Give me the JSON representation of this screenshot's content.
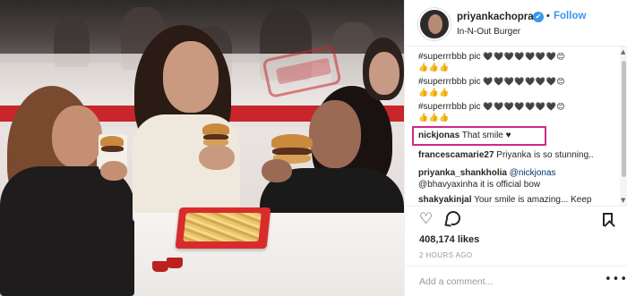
{
  "post": {
    "username": "priyankachopra",
    "verified_mark": "✔",
    "separator": "•",
    "follow_label": "Follow",
    "location": "In-N-Out Burger"
  },
  "comments": [
    {
      "user": "",
      "text": "#superrrbbb pic",
      "emoji": "🖤🖤🖤🖤🖤🖤🖤😊",
      "emoji2": "👍👍👍"
    },
    {
      "user": "",
      "text": "#superrrbbb pic",
      "emoji": "🖤🖤🖤🖤🖤🖤🖤😊",
      "emoji2": "👍👍👍"
    },
    {
      "user": "",
      "text": "#superrrbbb pic",
      "emoji": "🖤🖤🖤🖤🖤🖤🖤😊",
      "emoji2": "👍👍👍"
    },
    {
      "user": "nickjonas",
      "text": "That smile ♥",
      "highlighted": true
    },
    {
      "user": "francescamarie27",
      "text": "Priyanka is so stunning.."
    },
    {
      "user": "priyanka_shankholia",
      "text": "@nickjonas"
    },
    {
      "user": "",
      "text": "@bhavyaxinha it is official bow"
    },
    {
      "user": "shakyakinjal",
      "text": "Your smile is amazing... Keep"
    }
  ],
  "scroll": {
    "up": "▲",
    "down": "▼"
  },
  "actions": {
    "like_icon": "♡",
    "comment_icon": "comment-icon",
    "save_icon": "bookmark-icon"
  },
  "likes": "408,174 likes",
  "timestamp": "2 HOURS AGO",
  "add_comment": {
    "placeholder": "Add a comment...",
    "more": "•••"
  },
  "colors": {
    "accent": "#3897f0",
    "highlight": "#d0278a",
    "tray": "#d82c2c"
  }
}
